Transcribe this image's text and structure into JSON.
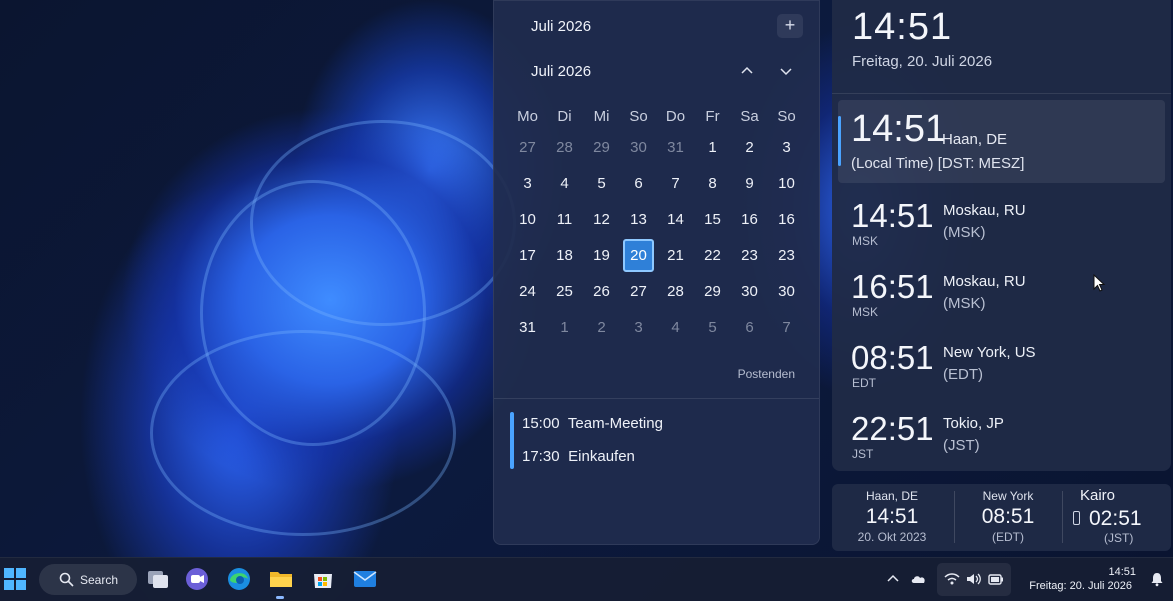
{
  "calendar": {
    "header_title": "Juli 2026",
    "add_label": "+",
    "month_label": "Juli 2026",
    "weekdays": [
      "Mo",
      "Di",
      "Mi",
      "So",
      "Do",
      "Fr",
      "Sa",
      "So"
    ],
    "weeks": [
      [
        "27",
        "28",
        "29",
        "30",
        "31",
        "1",
        "2",
        "3"
      ],
      [
        "3",
        "4",
        "5",
        "6",
        "7",
        "8",
        "9",
        "10"
      ],
      [
        "10",
        "11",
        "12",
        "13",
        "14",
        "15",
        "16",
        "16"
      ],
      [
        "17",
        "18",
        "19",
        "20",
        "21",
        "22",
        "23",
        "23"
      ],
      [
        "24",
        "25",
        "26",
        "27",
        "28",
        "29",
        "30",
        "30"
      ],
      [
        "31",
        "1",
        "2",
        "3",
        "4",
        "5",
        "6",
        "7"
      ]
    ],
    "selected_day": "20",
    "events_link": "Postenden",
    "events": [
      {
        "time": "15:00",
        "title": "Team-Meeting"
      },
      {
        "time": "17:30",
        "title": "Einkaufen"
      }
    ]
  },
  "clock": {
    "time": "14:51",
    "date": "Freitag, 20. Juli 2026",
    "local": {
      "time": "14:51",
      "city": "Haan, DE",
      "sub": "(Local Time) [DST: MESZ]"
    },
    "zones": [
      {
        "time": "14:51",
        "abbr": "MSK",
        "city": "Moskau, RU",
        "tz": "(MSK)"
      },
      {
        "time": "16:51",
        "abbr": "MSK",
        "city": "Moskau, RU",
        "tz": "(MSK)"
      },
      {
        "time": "08:51",
        "abbr": "EDT",
        "city": "New York, US",
        "tz": "(EDT)"
      },
      {
        "time": "22:51",
        "abbr": "JST",
        "city": "Tokio, JP",
        "tz": "(JST)"
      }
    ]
  },
  "mini_clocks": {
    "haan": {
      "city": "Haan, DE",
      "time": "14:51",
      "sub": "20. Okt 2023"
    },
    "newyork": {
      "city": "New York",
      "time": "08:51",
      "sub": "(EDT)"
    },
    "kairo": {
      "city": "Kairo",
      "time": "02:51",
      "sub": "(JST)"
    }
  },
  "taskbar": {
    "search_label": "Search",
    "time": "14:51",
    "date": "Freitag: 20. Juli 2026"
  },
  "colors": {
    "accent": "#4aa3ff",
    "selected_day": "#2f80d8",
    "panel": "#202a46"
  }
}
